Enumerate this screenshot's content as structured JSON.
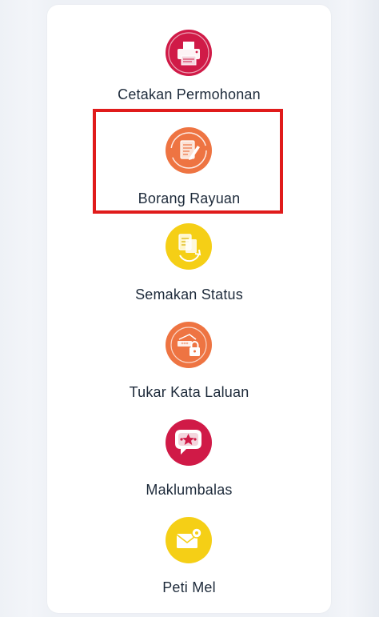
{
  "menu": {
    "items": [
      {
        "label": "Cetakan Permohonan",
        "icon": "printer-icon",
        "color": "#d01a47"
      },
      {
        "label": "Borang Rayuan",
        "icon": "document-edit-icon",
        "color": "#ee7442"
      },
      {
        "label": "Semakan Status",
        "icon": "document-search-icon",
        "color": "#f5cf16"
      },
      {
        "label": "Tukar Kata Laluan",
        "icon": "password-lock-icon",
        "color": "#ee7442"
      },
      {
        "label": "Maklumbalas",
        "icon": "feedback-chat-icon",
        "color": "#d01a47"
      },
      {
        "label": "Peti Mel",
        "icon": "mail-icon",
        "color": "#f5cf16"
      }
    ]
  },
  "highlight": {
    "target": "Borang Rayuan",
    "color": "#e01b1b"
  }
}
